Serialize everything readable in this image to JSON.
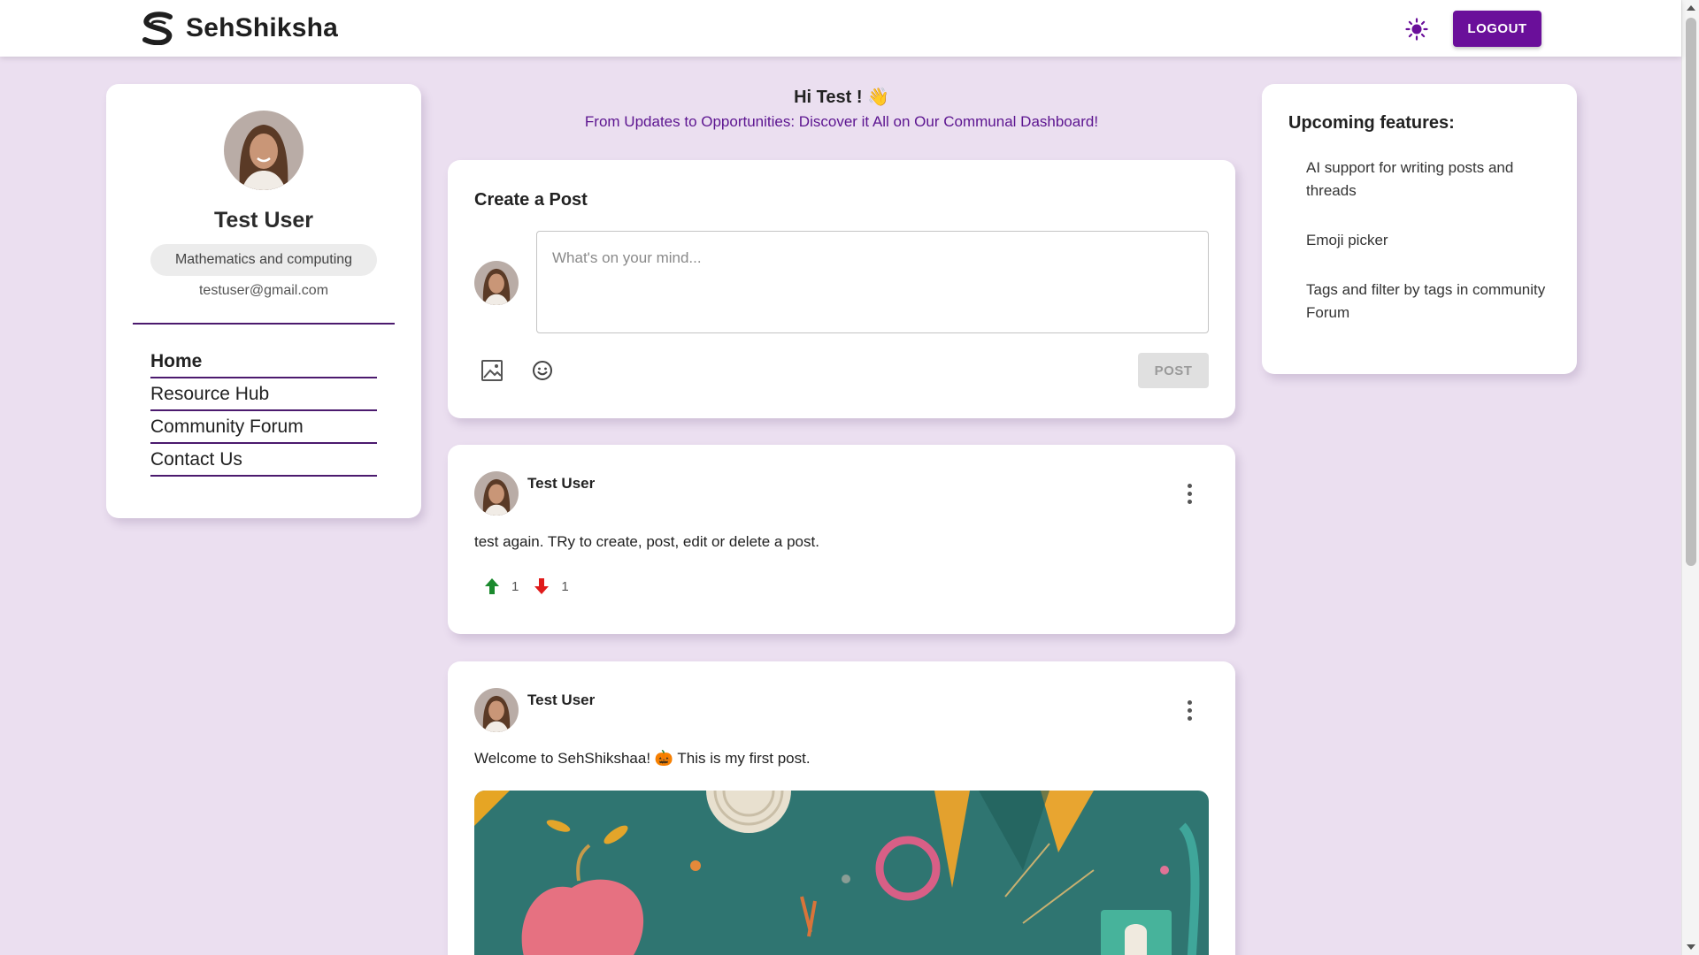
{
  "header": {
    "brand_name": "SehShiksha",
    "logout_label": "LOGOUT",
    "accent_color": "#6a0f9a"
  },
  "profile": {
    "name": "Test User",
    "department": "Mathematics and computing",
    "email": "testuser@gmail.com"
  },
  "nav": {
    "items": [
      {
        "label": "Home"
      },
      {
        "label": "Resource Hub"
      },
      {
        "label": "Community Forum"
      },
      {
        "label": "Contact Us"
      }
    ]
  },
  "greeting": {
    "title": "Hi Test ! 👋",
    "subtitle": "From Updates to Opportunities: Discover it All on Our Communal Dashboard!"
  },
  "create_post": {
    "title": "Create a Post",
    "placeholder": "What's on your mind...",
    "post_label": "POST"
  },
  "posts": [
    {
      "author": "Test User",
      "text": "test again. TRy to create, post, edit or delete a post.",
      "upvotes": "1",
      "downvotes": "1"
    },
    {
      "author": "Test User",
      "text": "Welcome to SehShikshaa! 🎃 This is my first post."
    }
  ],
  "features": {
    "title": "Upcoming features:",
    "items": [
      {
        "label": "AI support for writing posts and threads"
      },
      {
        "label": "Emoji picker"
      },
      {
        "label": "Tags and filter by tags in community Forum"
      }
    ]
  }
}
